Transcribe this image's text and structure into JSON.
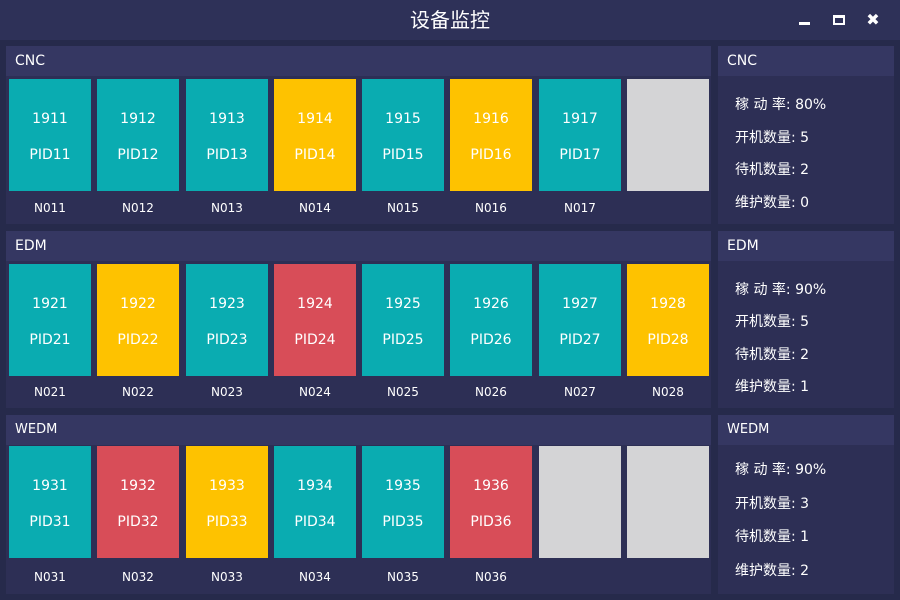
{
  "window": {
    "title": "设备监控",
    "minimize_icon": "minimize-icon",
    "maximize_icon": "maximize-icon",
    "close_icon": "close-icon",
    "close_glyph": "✖"
  },
  "colors": {
    "running": "#0aacb1",
    "standby": "#fec200",
    "maintenance": "#d84d58",
    "empty": "#d4d4d6"
  },
  "groups": [
    {
      "name": "CNC",
      "tiles": [
        {
          "id": "1911",
          "pid": "PID11",
          "label": "N011",
          "status": "running"
        },
        {
          "id": "1912",
          "pid": "PID12",
          "label": "N012",
          "status": "running"
        },
        {
          "id": "1913",
          "pid": "PID13",
          "label": "N013",
          "status": "running"
        },
        {
          "id": "1914",
          "pid": "PID14",
          "label": "N014",
          "status": "standby"
        },
        {
          "id": "1915",
          "pid": "PID15",
          "label": "N015",
          "status": "running"
        },
        {
          "id": "1916",
          "pid": "PID16",
          "label": "N016",
          "status": "standby"
        },
        {
          "id": "1917",
          "pid": "PID17",
          "label": "N017",
          "status": "running"
        },
        {
          "id": "",
          "pid": "",
          "label": "",
          "status": "empty"
        }
      ],
      "stats": {
        "rate": "稼 动 率: 80%",
        "running": "开机数量: 5",
        "standby": "待机数量: 2",
        "maintenance": "维护数量: 0"
      }
    },
    {
      "name": "EDM",
      "tiles": [
        {
          "id": "1921",
          "pid": "PID21",
          "label": "N021",
          "status": "running"
        },
        {
          "id": "1922",
          "pid": "PID22",
          "label": "N022",
          "status": "standby"
        },
        {
          "id": "1923",
          "pid": "PID23",
          "label": "N023",
          "status": "running"
        },
        {
          "id": "1924",
          "pid": "PID24",
          "label": "N024",
          "status": "maintenance"
        },
        {
          "id": "1925",
          "pid": "PID25",
          "label": "N025",
          "status": "running"
        },
        {
          "id": "1926",
          "pid": "PID26",
          "label": "N026",
          "status": "running"
        },
        {
          "id": "1927",
          "pid": "PID27",
          "label": "N027",
          "status": "running"
        },
        {
          "id": "1928",
          "pid": "PID28",
          "label": "N028",
          "status": "standby"
        }
      ],
      "stats": {
        "rate": "稼 动 率: 90%",
        "running": "开机数量: 5",
        "standby": "待机数量: 2",
        "maintenance": "维护数量: 1"
      }
    },
    {
      "name": "WEDM",
      "tiles": [
        {
          "id": "1931",
          "pid": "PID31",
          "label": "N031",
          "status": "running"
        },
        {
          "id": "1932",
          "pid": "PID32",
          "label": "N032",
          "status": "maintenance"
        },
        {
          "id": "1933",
          "pid": "PID33",
          "label": "N033",
          "status": "standby"
        },
        {
          "id": "1934",
          "pid": "PID34",
          "label": "N034",
          "status": "running"
        },
        {
          "id": "1935",
          "pid": "PID35",
          "label": "N035",
          "status": "running"
        },
        {
          "id": "1936",
          "pid": "PID36",
          "label": "N036",
          "status": "maintenance"
        },
        {
          "id": "",
          "pid": "",
          "label": "",
          "status": "empty"
        },
        {
          "id": "",
          "pid": "",
          "label": "",
          "status": "empty"
        }
      ],
      "stats": {
        "rate": "稼 动 率: 90%",
        "running": "开机数量: 3",
        "standby": "待机数量: 1",
        "maintenance": "维护数量: 2"
      }
    }
  ]
}
